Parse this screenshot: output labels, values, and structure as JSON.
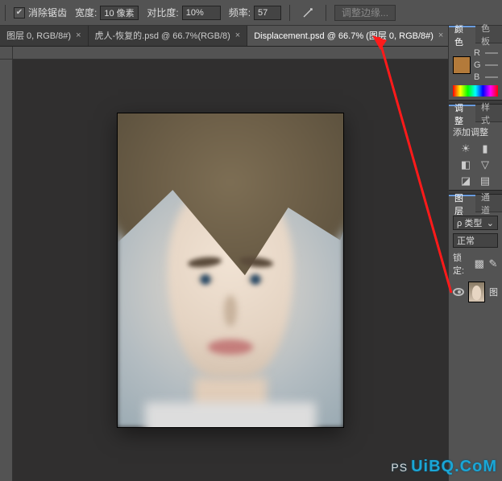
{
  "toolbar": {
    "antialias_label": "消除锯齿",
    "antialias_checked": true,
    "width_label": "宽度:",
    "width_value": "10 像素",
    "contrast_label": "对比度:",
    "contrast_value": "10%",
    "frequency_label": "频率:",
    "frequency_value": "57",
    "refine_edge_label": "调整边缘..."
  },
  "tabs": [
    {
      "label": "图层 0, RGB/8#)",
      "active": false
    },
    {
      "label": "虎人-恢复的.psd @ 66.7%(RGB/8)",
      "active": false
    },
    {
      "label": "Displacement.psd @ 66.7% (图层 0, RGB/8#)",
      "active": true
    }
  ],
  "panels": {
    "color": {
      "tab_color": "颜色",
      "tab_swatch": "色板",
      "swatch_hex": "#b37a3a",
      "channels": [
        "R",
        "G",
        "B"
      ]
    },
    "adjust": {
      "tab_adjust": "调整",
      "tab_style": "样式",
      "add_label": "添加调整"
    },
    "layers": {
      "tab_layer": "图层",
      "tab_channel": "通道",
      "filter_label": "类型",
      "blend_mode": "正常",
      "lock_label": "锁定:",
      "layer0_name": "图",
      "visibility": true
    }
  },
  "watermark": {
    "prefix": "PS",
    "text": "UiBQ.CoM"
  }
}
